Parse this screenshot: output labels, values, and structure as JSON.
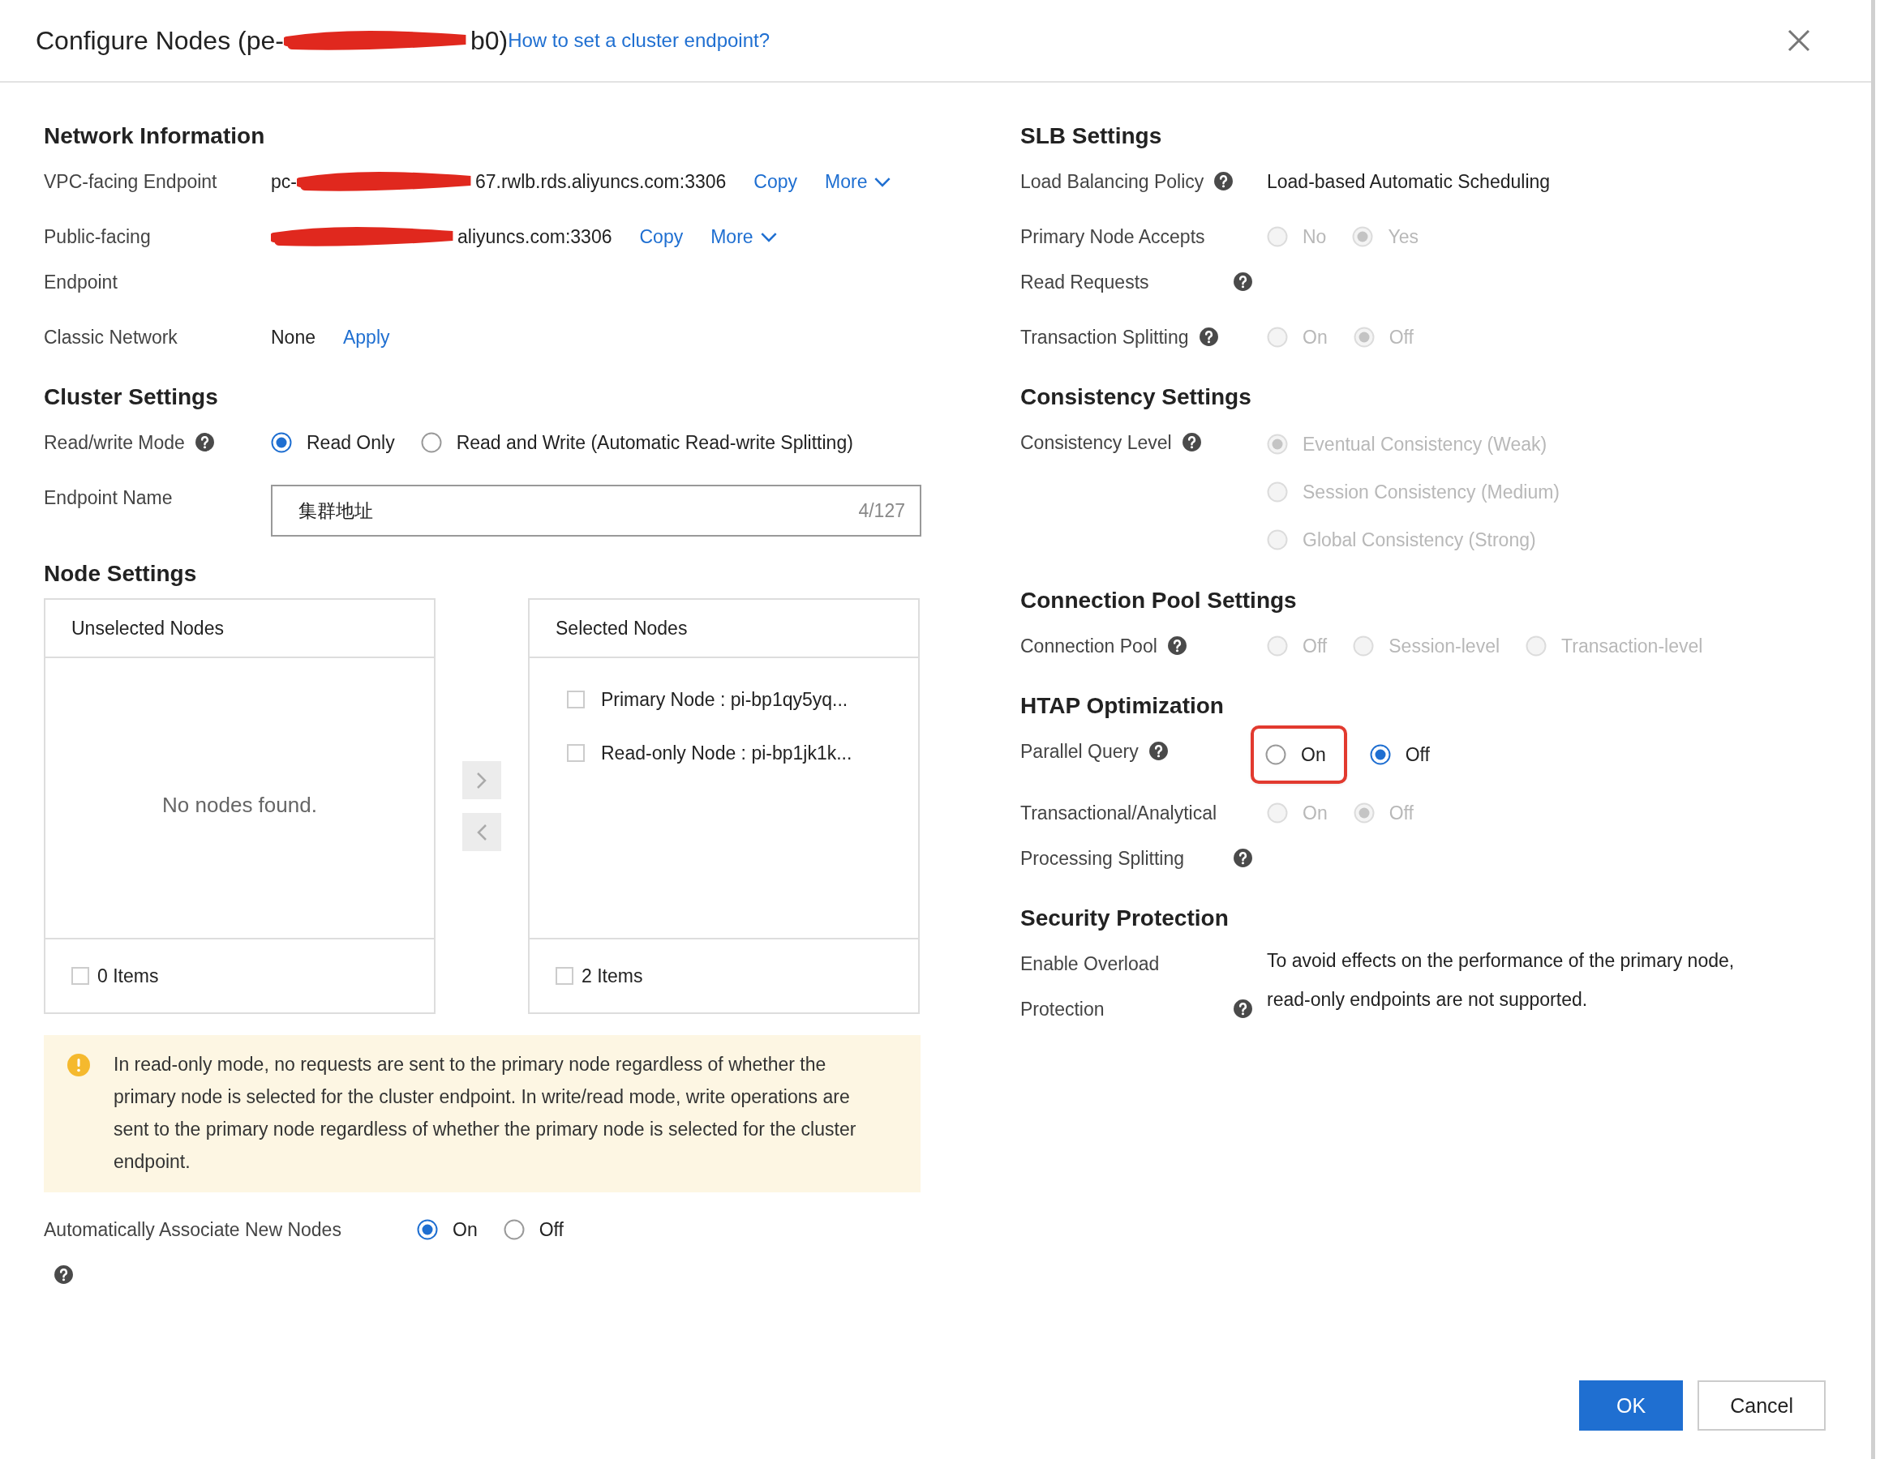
{
  "dialog": {
    "title_start": "Configure Nodes (pe-",
    "title_end": "b0)",
    "help_link": "How to set a cluster endpoint?"
  },
  "left": [
    {
      "heading": "Network Information",
      "rows": [
        {
          "kind": "endpoint",
          "label": "VPC-facing Endpoint",
          "value_start": "pc-",
          "value_end": "67.rwlb.rds.aliyuncs.com:3306",
          "actions": [
            {
              "label": "Copy",
              "caret": false
            },
            {
              "label": "More",
              "caret": true
            }
          ]
        },
        {
          "kind": "endpoint",
          "label": "Public-facing Endpoint",
          "value_end": "aliyuncs.com:3306",
          "actions": [
            {
              "label": "Copy",
              "caret": false
            },
            {
              "label": "More",
              "caret": true
            }
          ]
        },
        {
          "kind": "text",
          "label": "Classic Network",
          "value": "None",
          "link": "Apply"
        }
      ]
    },
    {
      "heading": "Cluster Settings",
      "rows": [
        {
          "kind": "radio",
          "label": "Read/write Mode",
          "help": true,
          "options": [
            {
              "label": "Read Only",
              "selected": true,
              "disabled": false
            },
            {
              "label": "Read and Write (Automatic Read-write Splitting)",
              "selected": false,
              "disabled": false
            }
          ]
        },
        {
          "kind": "input",
          "label": "Endpoint Name",
          "value": "集群地址",
          "counter": "4/127"
        }
      ]
    }
  ],
  "node_settings": {
    "heading": "Node Settings",
    "unselected": {
      "title": "Unselected Nodes",
      "empty": "No nodes found.",
      "count": "0 Items",
      "all_checked": false
    },
    "selected": {
      "title": "Selected Nodes",
      "items": [
        {
          "label": "Primary Node : pi-bp1qy5yq...",
          "checked": false
        },
        {
          "label": "Read-only Node : pi-bp1jk1k...",
          "checked": false
        }
      ],
      "count": "2 Items",
      "all_checked": false
    }
  },
  "alert": "In read-only mode, no requests are sent to the primary node regardless of whether the primary node is selected for the cluster endpoint. In write/read mode, write operations are sent to the primary node regardless of whether the primary node is selected for the cluster endpoint.",
  "auto_associate": {
    "label": "Automatically Associate New Nodes",
    "help": true,
    "options": [
      {
        "label": "On",
        "selected": true,
        "disabled": false
      },
      {
        "label": "Off",
        "selected": false,
        "disabled": false
      }
    ]
  },
  "right": [
    {
      "heading": "SLB Settings",
      "rows": [
        {
          "kind": "text",
          "label": "Load Balancing Policy",
          "help": true,
          "value": "Load-based Automatic Scheduling"
        },
        {
          "kind": "radio",
          "label": "Primary Node Accepts Read Requests",
          "help": true,
          "options": [
            {
              "label": "No",
              "selected": false,
              "disabled": true
            },
            {
              "label": "Yes",
              "selected": true,
              "disabled": true
            }
          ]
        },
        {
          "kind": "radio",
          "label": "Transaction Splitting",
          "help": true,
          "options": [
            {
              "label": "On",
              "selected": false,
              "disabled": true
            },
            {
              "label": "Off",
              "selected": true,
              "disabled": true
            }
          ]
        }
      ]
    },
    {
      "heading": "Consistency Settings",
      "rows": [
        {
          "kind": "radio-vertical",
          "label": "Consistency Level",
          "help": true,
          "options": [
            {
              "label": "Eventual Consistency (Weak)",
              "selected": true,
              "disabled": true
            },
            {
              "label": "Session Consistency (Medium)",
              "selected": false,
              "disabled": true
            },
            {
              "label": "Global Consistency (Strong)",
              "selected": false,
              "disabled": true
            }
          ]
        }
      ]
    },
    {
      "heading": "Connection Pool Settings",
      "rows": [
        {
          "kind": "radio",
          "label": "Connection Pool",
          "help": true,
          "options": [
            {
              "label": "Off",
              "selected": false,
              "disabled": true
            },
            {
              "label": "Session-level",
              "selected": false,
              "disabled": true
            },
            {
              "label": "Transaction-level",
              "selected": false,
              "disabled": true
            }
          ]
        }
      ]
    },
    {
      "heading": "HTAP Optimization",
      "rows": [
        {
          "kind": "radio",
          "label": "Parallel Query",
          "help": true,
          "options": [
            {
              "label": "On",
              "selected": false,
              "disabled": false,
              "highlighted": true
            },
            {
              "label": "Off",
              "selected": true,
              "disabled": false,
              "highlighted": false
            }
          ]
        },
        {
          "kind": "radio",
          "label": "Transactional/Analytical Processing Splitting",
          "help": true,
          "options": [
            {
              "label": "On",
              "selected": false,
              "disabled": true
            },
            {
              "label": "Off",
              "selected": true,
              "disabled": true
            }
          ]
        }
      ]
    },
    {
      "heading": "Security Protection",
      "rows": [
        {
          "kind": "note",
          "label": "Enable Overload Protection",
          "help": true,
          "value": "To avoid effects on the performance of the primary node, read-only endpoints are not supported."
        }
      ]
    }
  ],
  "buttons": [
    {
      "label": "OK",
      "primary": true
    },
    {
      "label": "Cancel",
      "primary": false
    }
  ]
}
